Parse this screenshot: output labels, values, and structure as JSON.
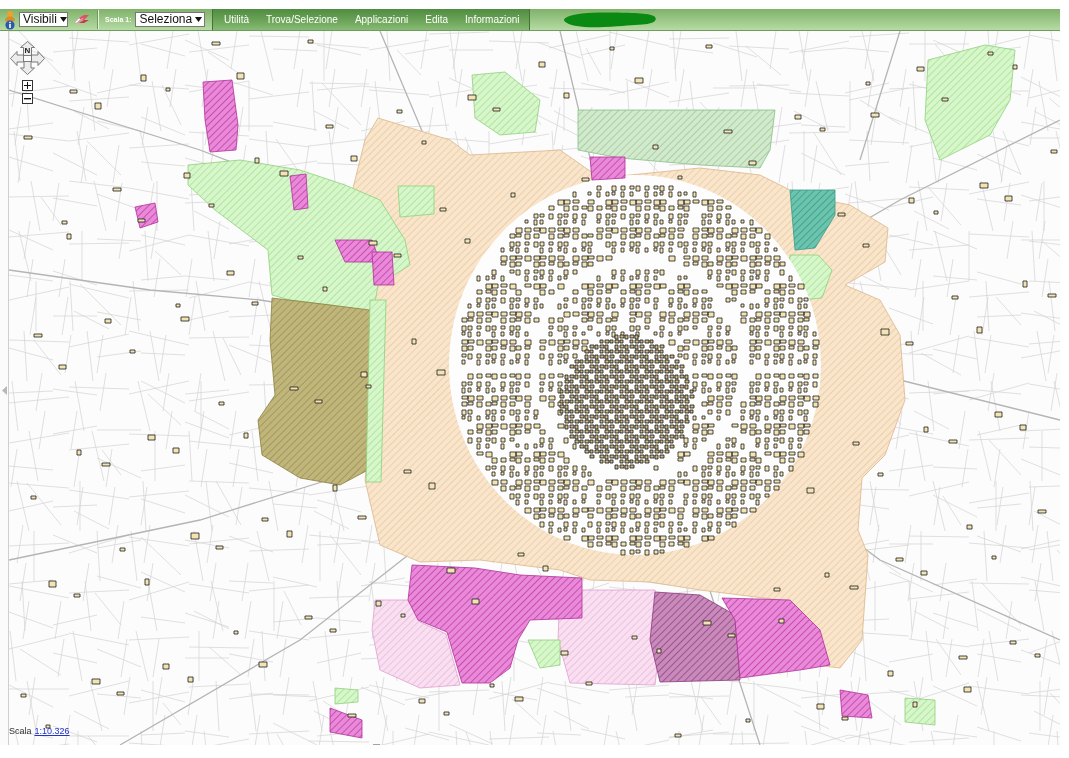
{
  "toolbar": {
    "layer_select": {
      "value": "Visibili"
    },
    "scale_label": "Scala 1:",
    "scale_select": {
      "value": "Seleziona"
    },
    "menu": [
      {
        "label": "Utilità"
      },
      {
        "label": "Trova/Selezione"
      },
      {
        "label": "Applicazioni"
      },
      {
        "label": "Edita"
      },
      {
        "label": "Informazioni"
      }
    ]
  },
  "map_controls": {
    "pan_north_label": "N"
  },
  "scale_bar": {
    "label": "Scala",
    "value": "1:10.326"
  }
}
